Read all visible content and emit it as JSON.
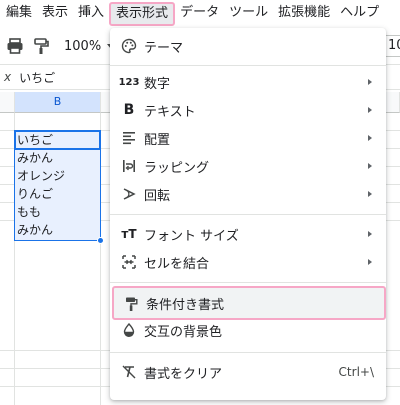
{
  "menubar": {
    "items": [
      "編集",
      "表示",
      "挿入",
      "表示形式",
      "データ",
      "ツール",
      "拡張機能",
      "ヘルプ"
    ],
    "active_index": 3
  },
  "toolbar": {
    "zoom": "100%",
    "font_size_partial": "10"
  },
  "formula_bar": {
    "fx": "x",
    "value": "いちご"
  },
  "grid": {
    "column_b": "B",
    "cells": [
      "いちご",
      "みかん",
      "オレンジ",
      "りんご",
      "もも",
      "みかん"
    ]
  },
  "format_menu": {
    "items": [
      {
        "label": "テーマ",
        "icon": "palette-icon"
      },
      {
        "label": "数字",
        "icon": "number-format-icon",
        "icon_text": "123",
        "submenu": true
      },
      {
        "label": "テキスト",
        "icon": "bold-icon",
        "icon_text": "B",
        "submenu": true
      },
      {
        "label": "配置",
        "icon": "align-icon",
        "submenu": true
      },
      {
        "label": "ラッピング",
        "icon": "wrap-icon",
        "submenu": true
      },
      {
        "label": "回転",
        "icon": "rotate-icon",
        "submenu": true
      },
      {
        "label": "フォント サイズ",
        "icon": "font-size-icon",
        "icon_text": "тT",
        "submenu": true
      },
      {
        "label": "セルを結合",
        "icon": "merge-cells-icon",
        "submenu": true
      },
      {
        "label": "条件付き書式",
        "icon": "paint-roller-icon",
        "highlighted": true
      },
      {
        "label": "交互の背景色",
        "icon": "fill-drop-icon"
      },
      {
        "label": "書式をクリア",
        "icon": "clear-format-icon",
        "shortcut": "Ctrl+\\"
      }
    ]
  },
  "colors": {
    "accent": "#1a73e8",
    "highlight_border": "#f6a7c6",
    "selection_fill": "#e8f0fe"
  }
}
